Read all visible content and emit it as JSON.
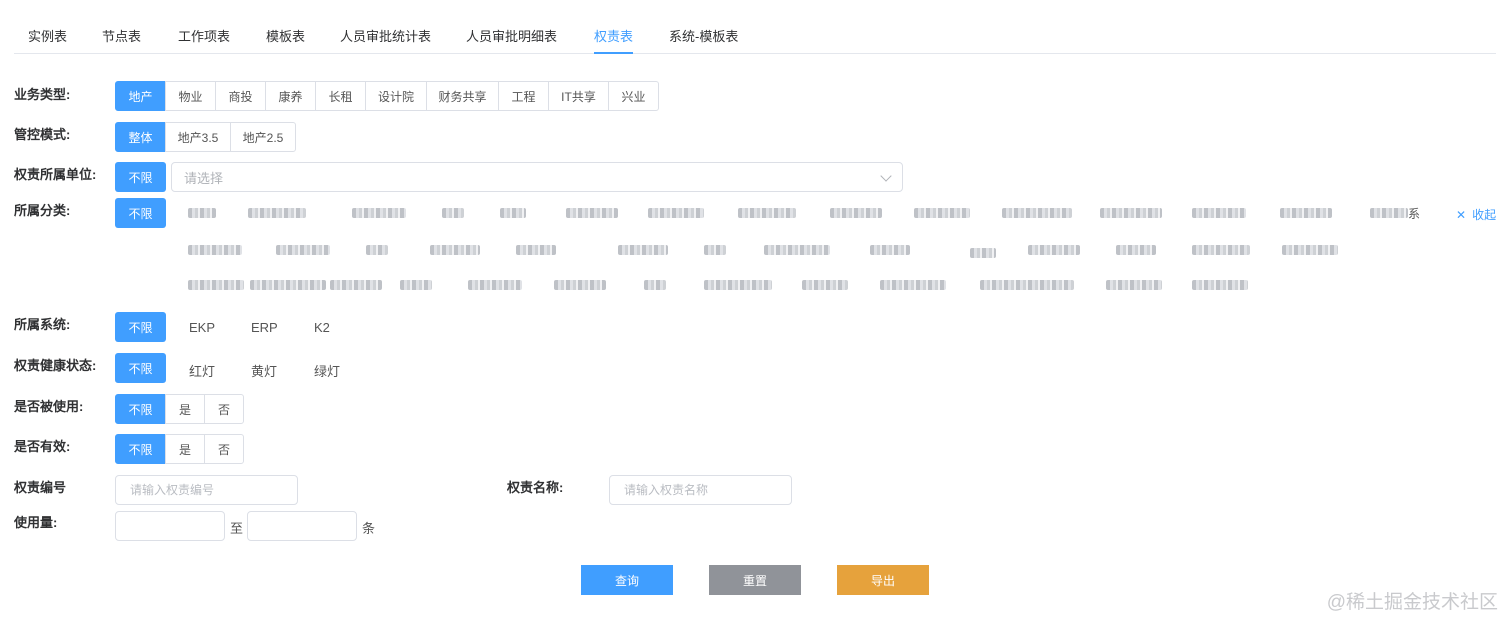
{
  "tabs": [
    "实例表",
    "节点表",
    "工作项表",
    "模板表",
    "人员审批统计表",
    "人员审批明细表",
    "权责表",
    "系统-模板表"
  ],
  "active_tab": "权责表",
  "filters": {
    "business_type": {
      "label": "业务类型:",
      "options": [
        "地产",
        "物业",
        "商投",
        "康养",
        "长租",
        "设计院",
        "财务共享",
        "工程",
        "IT共享",
        "兴业"
      ],
      "selected": "地产"
    },
    "control_mode": {
      "label": "管控模式:",
      "options": [
        "整体",
        "地产3.5",
        "地产2.5"
      ],
      "selected": "整体"
    },
    "owner_unit": {
      "label": "权责所属单位:",
      "unlimited": "不限",
      "placeholder": "请选择"
    },
    "category": {
      "label": "所属分类:",
      "unlimited": "不限",
      "visible_fragment": "系",
      "collapse_label": "收起"
    },
    "system": {
      "label": "所属系统:",
      "unlimited": "不限",
      "options": [
        "EKP",
        "ERP",
        "K2"
      ]
    },
    "health": {
      "label": "权责健康状态:",
      "unlimited": "不限",
      "options": [
        "红灯",
        "黄灯",
        "绿灯"
      ]
    },
    "used": {
      "label": "是否被使用:",
      "options": [
        "不限",
        "是",
        "否"
      ],
      "selected": "不限"
    },
    "valid": {
      "label": "是否有效:",
      "options": [
        "不限",
        "是",
        "否"
      ],
      "selected": "不限"
    },
    "code": {
      "label": "权责编号",
      "placeholder": "请输入权责编号"
    },
    "name": {
      "label": "权责名称:",
      "placeholder": "请输入权责名称"
    },
    "usage": {
      "label": "使用量:",
      "from": "",
      "to_label": "至",
      "to": "",
      "unit": "条"
    }
  },
  "actions": {
    "query": "查询",
    "reset": "重置",
    "export": "导出"
  },
  "watermark": "@稀土掘金技术社区",
  "colors": {
    "primary": "#409eff",
    "reset": "#909399",
    "export": "#e6a23c",
    "border": "#dcdfe6"
  }
}
